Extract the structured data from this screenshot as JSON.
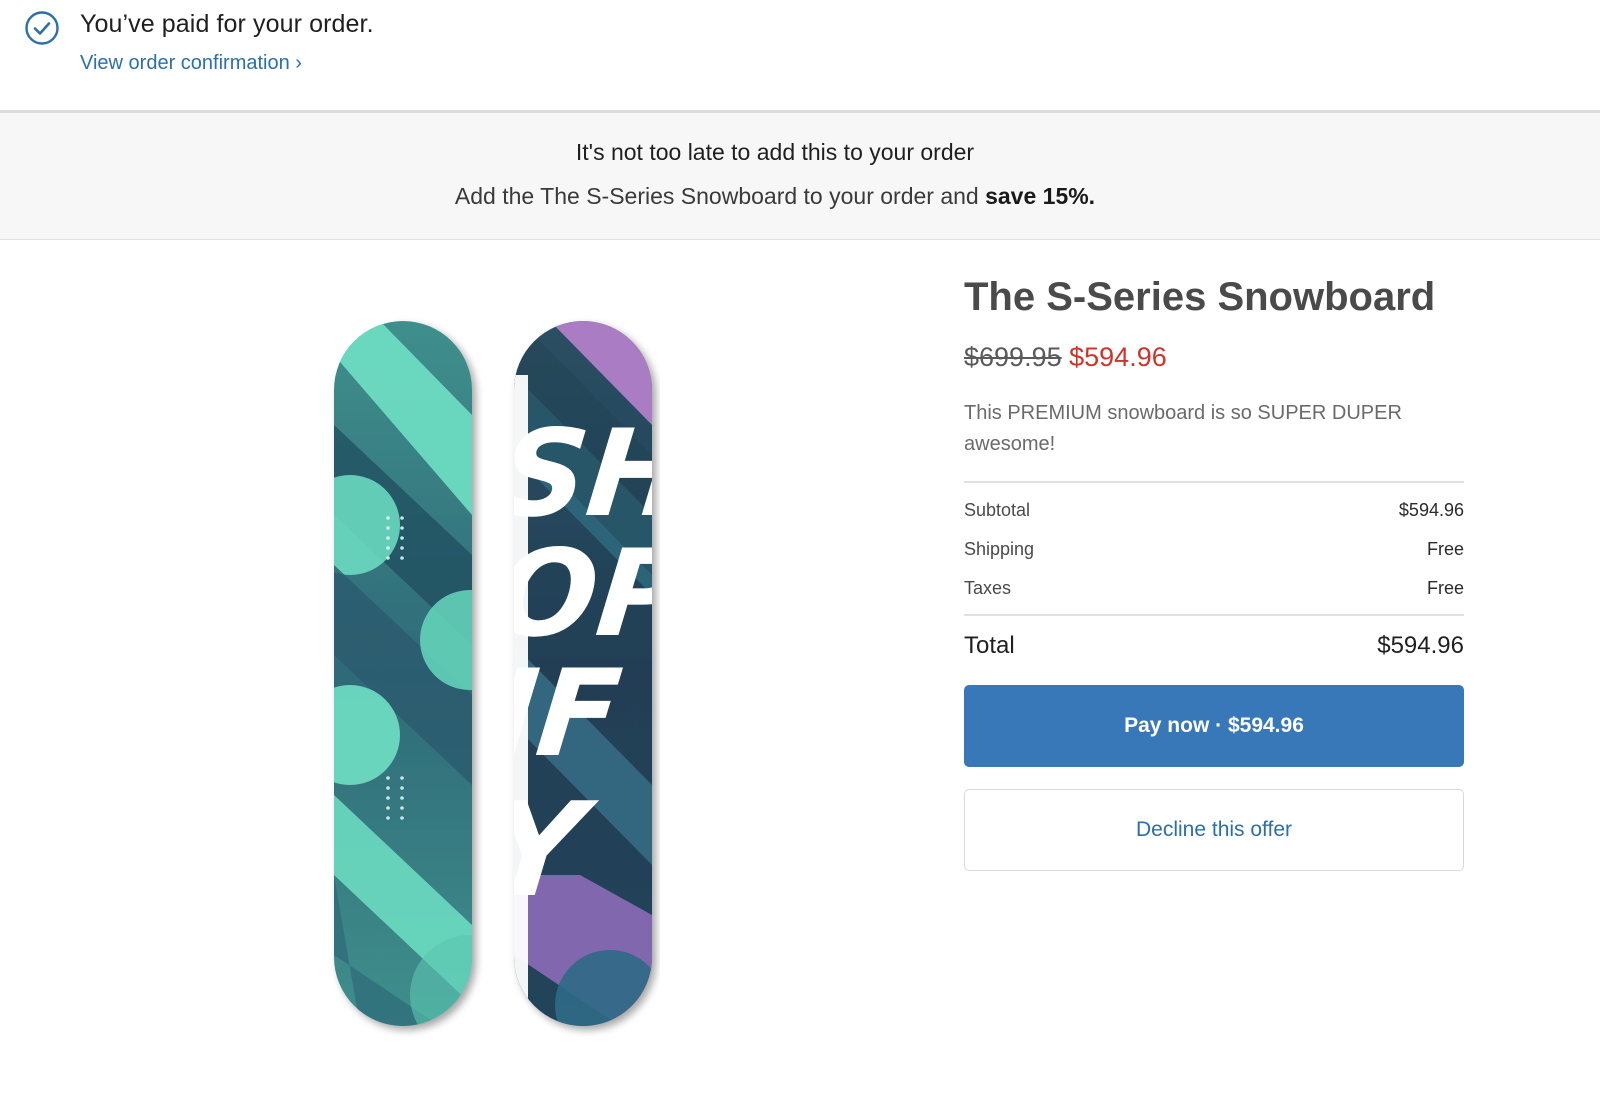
{
  "header": {
    "status_title": "You’ve paid for your order.",
    "confirmation_link": "View order confirmation ›"
  },
  "banner": {
    "title": "It's not too late to add this to your order",
    "subtitle_prefix": "Add the The S-Series Snowboard to your order and",
    "subtitle_bold": "save 15%."
  },
  "product": {
    "title": "The S-Series Snowboard",
    "original_price": "$699.95",
    "sale_price": "$594.96",
    "description": "This PREMIUM snowboard is so SUPER DUPER awesome!",
    "board_lettering": "SHOPIFY"
  },
  "summary": {
    "subtotal_label": "Subtotal",
    "subtotal_value": "$594.96",
    "shipping_label": "Shipping",
    "shipping_value": "Free",
    "taxes_label": "Taxes",
    "taxes_value": "Free",
    "total_label": "Total",
    "total_value": "$594.96"
  },
  "actions": {
    "pay_label": "Pay now · $594.96",
    "decline_label": "Decline this offer"
  },
  "colors": {
    "accent": "#3878b9",
    "link": "#2a6fae",
    "sale": "#d0332a"
  }
}
